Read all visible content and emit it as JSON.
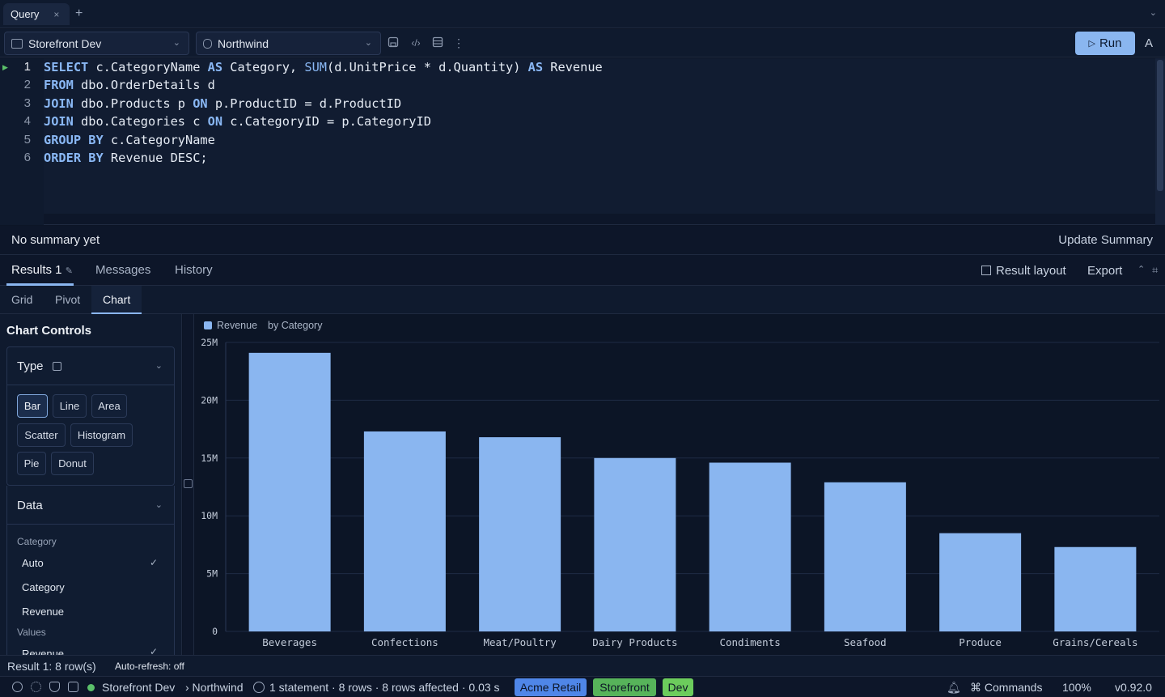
{
  "tabs": [
    {
      "label": "Query",
      "close": "×"
    }
  ],
  "tab_add": "+",
  "toolbar": {
    "connection": "Storefront Dev",
    "database": "Northwind",
    "run_label": "Run",
    "a_label": "A"
  },
  "editor": {
    "line_numbers": [
      "1",
      "2",
      "3",
      "4",
      "5",
      "6"
    ]
  },
  "summary": {
    "text": "No summary yet",
    "update_label": "Update Summary"
  },
  "results_tabs": {
    "results": "Results 1",
    "messages": "Messages",
    "history": "History",
    "result_layout": "Result layout",
    "export": "Export"
  },
  "view_tabs": {
    "grid": "Grid",
    "pivot": "Pivot",
    "chart": "Chart"
  },
  "chart_controls": {
    "title": "Chart Controls",
    "type_header": "Type",
    "types": [
      "Bar",
      "Line",
      "Area",
      "Scatter",
      "Histogram",
      "Pie",
      "Donut"
    ],
    "selected_type": "Bar",
    "data_header": "Data",
    "category_label": "Category",
    "category_options": [
      "Auto",
      "Category",
      "Revenue"
    ],
    "category_selected": "Auto",
    "values_label": "Values",
    "values_options": [
      "Revenue"
    ]
  },
  "chart_data": {
    "type": "bar",
    "legend": "Revenue",
    "subtitle": "by Category",
    "categories": [
      "Beverages",
      "Confections",
      "Meat/Poultry",
      "Dairy Products",
      "Condiments",
      "Seafood",
      "Produce",
      "Grains/Cereals"
    ],
    "series": [
      {
        "name": "Revenue",
        "values": [
          24100000,
          17300000,
          16800000,
          15000000,
          14600000,
          12900000,
          8500000,
          7300000
        ]
      }
    ],
    "ylim": [
      0,
      25000000
    ],
    "yticks": [
      "0",
      "5M",
      "10M",
      "15M",
      "20M",
      "25M"
    ],
    "grid": true,
    "bar_color": "#8ab6f0"
  },
  "status": {
    "result_rows": "Result 1: 8 row(s)",
    "auto_refresh": "Auto-refresh: off",
    "connection": "Storefront Dev",
    "database": "› Northwind",
    "stats": "1 statement · 8 rows · 8 rows affected · 0.03 s",
    "badges": [
      {
        "label": "Acme Retail",
        "color": "#4f86e8"
      },
      {
        "label": "Storefront",
        "color": "#57b35a"
      },
      {
        "label": "Dev",
        "color": "#6ccc5c"
      }
    ],
    "commands": "⌘ Commands",
    "zoom": "100%",
    "version": "v0.92.0"
  }
}
